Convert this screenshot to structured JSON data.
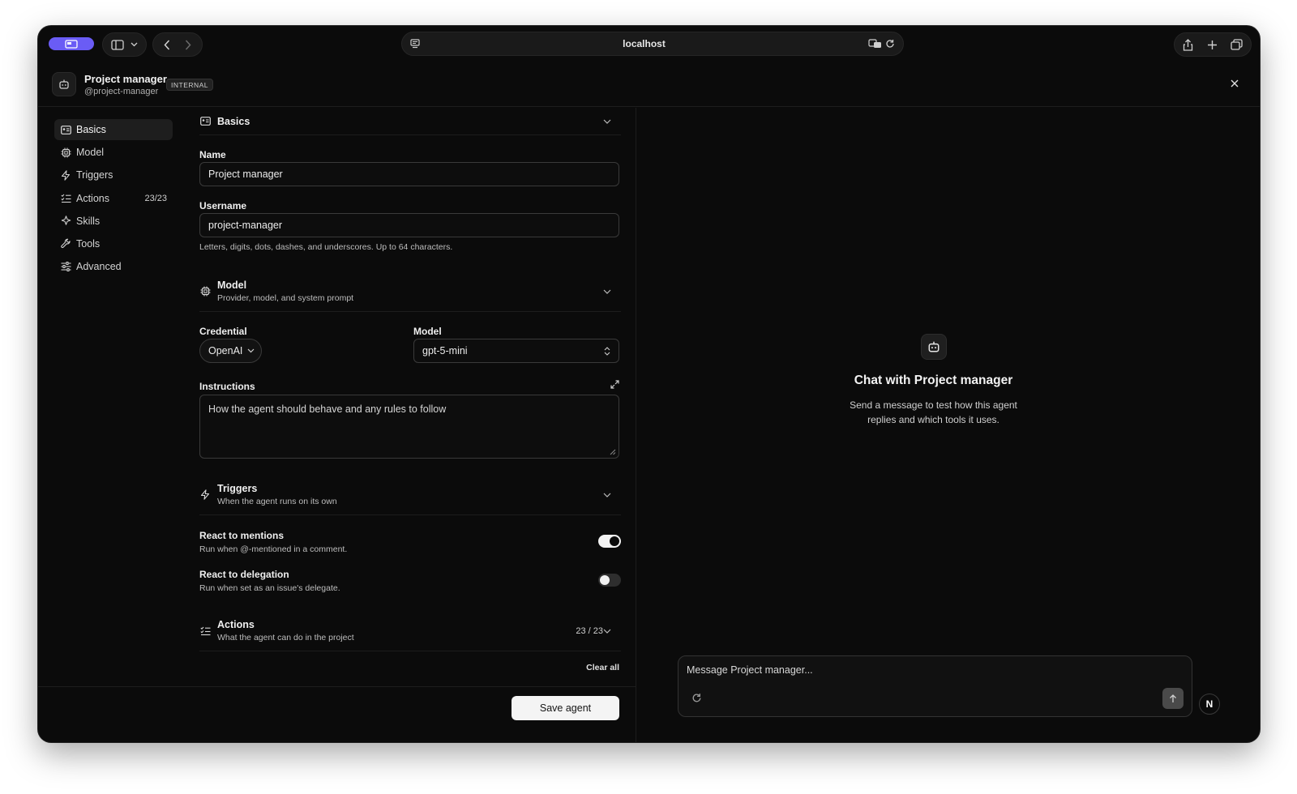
{
  "browser": {
    "url": "localhost",
    "icons": [
      "profile-icon",
      "sidebar-toggle-icon",
      "chevron-down-icon",
      "back-icon",
      "forward-icon",
      "page-menu-icon",
      "translate-icon",
      "reload-icon",
      "share-icon",
      "new-tab-icon",
      "tabs-overview-icon"
    ],
    "accent": "#6a5cf5"
  },
  "agent": {
    "name": "Project manager",
    "handle": "@project-manager",
    "badge": "INTERNAL"
  },
  "nav": {
    "items": [
      {
        "label": "Basics",
        "icon": "id-card-icon",
        "active": true
      },
      {
        "label": "Model",
        "icon": "chip-icon"
      },
      {
        "label": "Triggers",
        "icon": "lightning-icon"
      },
      {
        "label": "Actions",
        "icon": "checklist-icon",
        "count": "23/23"
      },
      {
        "label": "Skills",
        "icon": "sparkle-icon"
      },
      {
        "label": "Tools",
        "icon": "wrench-icon"
      },
      {
        "label": "Advanced",
        "icon": "sliders-icon"
      }
    ]
  },
  "basics": {
    "title": "Basics",
    "name_label": "Name",
    "name_value": "Project manager",
    "username_label": "Username",
    "username_value": "project-manager",
    "username_hint": "Letters, digits, dots, dashes, and underscores. Up to 64 characters."
  },
  "model": {
    "title": "Model",
    "subtitle": "Provider, model, and system prompt",
    "credential_label": "Credential",
    "credential_value": "OpenAI",
    "model_label": "Model",
    "model_value": "gpt-5-mini",
    "instructions_label": "Instructions",
    "instructions_placeholder": "How the agent should behave and any rules to follow"
  },
  "triggers": {
    "title": "Triggers",
    "subtitle": "When the agent runs on its own",
    "items": [
      {
        "title": "React to mentions",
        "subtitle": "Run when @-mentioned in a comment.",
        "enabled": true
      },
      {
        "title": "React to delegation",
        "subtitle": "Run when set as an issue's delegate.",
        "enabled": false
      }
    ]
  },
  "actions": {
    "title": "Actions",
    "subtitle": "What the agent can do in the project",
    "count": "23 / 23",
    "clear_all": "Clear all"
  },
  "footer": {
    "save_label": "Save agent"
  },
  "chat": {
    "title": "Chat with Project manager",
    "description": "Send a message to test how this agent replies and which tools it uses.",
    "placeholder": "Message Project manager...",
    "user_initial": "N"
  }
}
